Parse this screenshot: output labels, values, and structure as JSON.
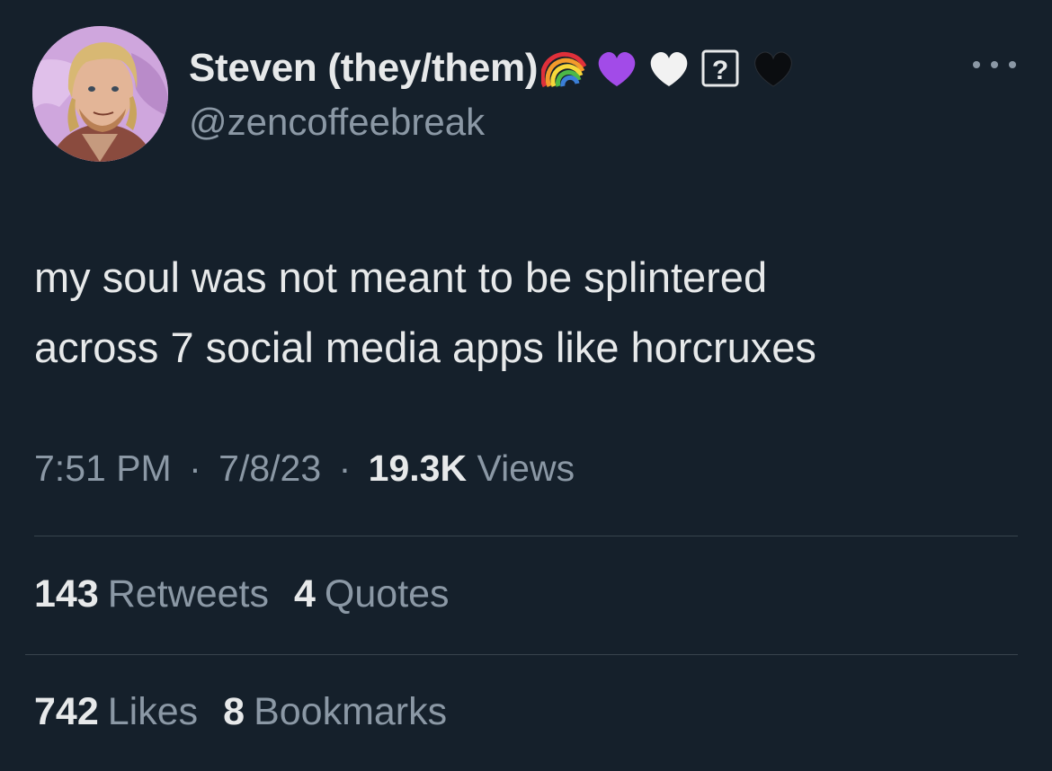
{
  "user": {
    "display_name": "Steven (they/them)",
    "handle": "@zencoffeebreak",
    "avatar_icon": "profile-photo",
    "name_emojis": [
      "rainbow-icon",
      "purple-heart-icon",
      "white-heart-icon",
      "unknown-glyph-icon",
      "black-heart-icon"
    ],
    "unknown_glyph": "?"
  },
  "tweet": {
    "line1": "my soul was not meant to be splintered",
    "line2": "across 7 social media apps like horcruxes"
  },
  "meta": {
    "time": "7:51 PM",
    "separator": "·",
    "date": "7/8/23",
    "views_count": "19.3K",
    "views_label": "Views"
  },
  "stats": {
    "retweets_count": "143",
    "retweets_label": "Retweets",
    "quotes_count": "4",
    "quotes_label": "Quotes",
    "likes_count": "742",
    "likes_label": "Likes",
    "bookmarks_count": "8",
    "bookmarks_label": "Bookmarks"
  },
  "colors": {
    "background": "#15202b",
    "primary_text": "#e7e9ea",
    "secondary_text": "#8b98a5",
    "divider": "#38444d"
  }
}
